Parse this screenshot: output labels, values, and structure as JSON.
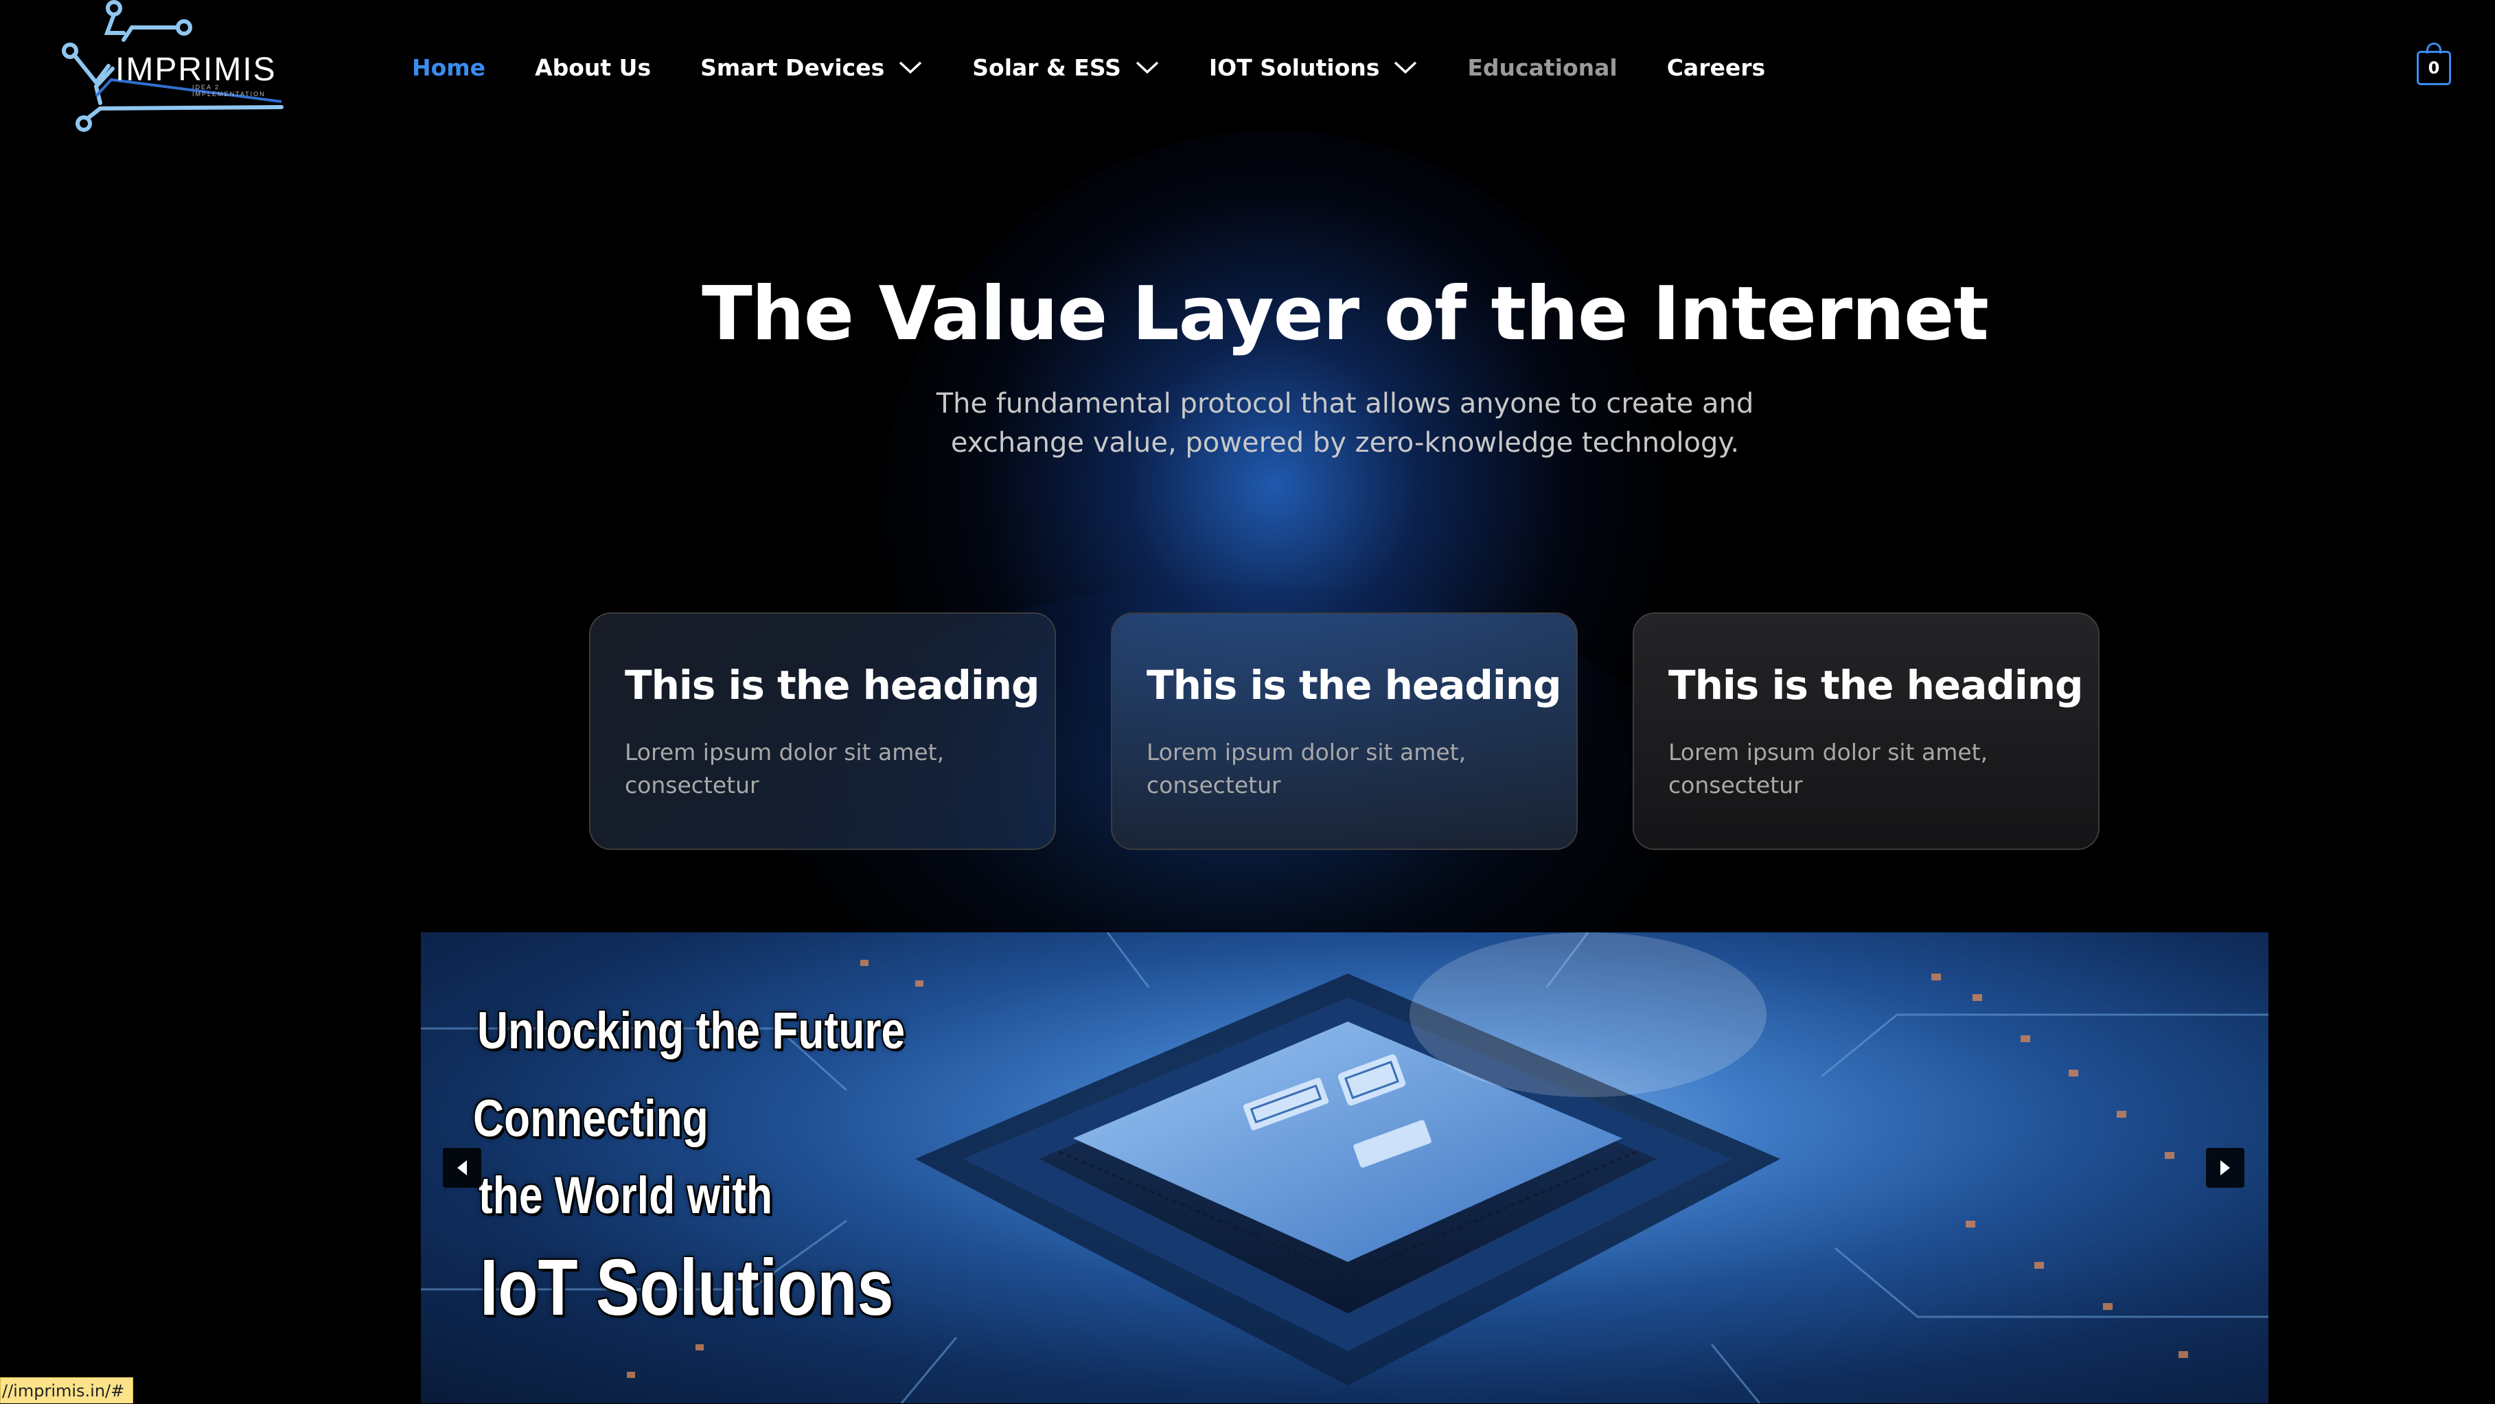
{
  "brand": {
    "name": "IMPRIMIS",
    "tagline": "IDEA 2 IMPLEMENTATION",
    "accent_color": "#3b8cf0"
  },
  "nav": {
    "items": [
      {
        "label": "Home",
        "state": "active"
      },
      {
        "label": "About Us"
      },
      {
        "label": "Smart Devices",
        "has_dropdown": true
      },
      {
        "label": "Solar & ESS",
        "has_dropdown": true
      },
      {
        "label": "IOT Solutions",
        "has_dropdown": true
      },
      {
        "label": "Educational",
        "state": "muted"
      },
      {
        "label": "Careers"
      }
    ]
  },
  "cart": {
    "count": "0",
    "icon": "shopping-bag-icon"
  },
  "hero": {
    "title": "The Value Layer of the Internet",
    "subtitle_line1": "The fundamental protocol that allows anyone to create and",
    "subtitle_line2": "exchange value, powered by zero-knowledge technology."
  },
  "cards": [
    {
      "heading": "This is the heading",
      "text_line1": "Lorem ipsum dolor sit amet,",
      "text_line2": "consectetur"
    },
    {
      "heading": "This is the heading",
      "text_line1": "Lorem ipsum dolor sit amet,",
      "text_line2": "consectetur"
    },
    {
      "heading": "This is the heading",
      "text_line1": "Lorem ipsum dolor sit amet,",
      "text_line2": "consectetur"
    }
  ],
  "banner": {
    "line1": "Unlocking the Future",
    "line2": "Connecting",
    "line3": "the World with",
    "line4": "IoT Solutions",
    "prev_icon": "arrow-left-icon",
    "next_icon": "arrow-right-icon"
  },
  "status_bar": {
    "url": "//imprimis.in/#"
  }
}
